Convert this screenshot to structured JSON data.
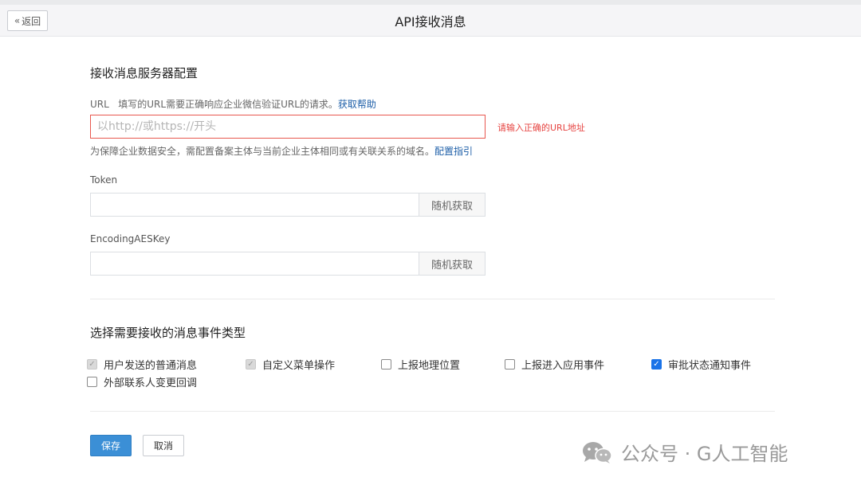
{
  "header": {
    "back_label": "返回",
    "title": "API接收消息"
  },
  "server_config": {
    "section_title": "接收消息服务器配置",
    "url_label": "URL",
    "url_hint": "填写的URL需要正确响应企业微信验证URL的请求。",
    "url_help_link": "获取帮助",
    "url_value": "",
    "url_placeholder": "以http://或https://开头",
    "url_error": "请输入正确的URL地址",
    "domain_hint": "为保障企业数据安全，需配置备案主体与当前企业主体相同或有关联关系的域名。",
    "domain_link": "配置指引",
    "token_label": "Token",
    "token_value": "",
    "token_random_label": "随机获取",
    "aes_label": "EncodingAESKey",
    "aes_value": "",
    "aes_random_label": "随机获取"
  },
  "event_types": {
    "section_title": "选择需要接收的消息事件类型",
    "options": [
      {
        "label": "用户发送的普通消息",
        "state": "checked-disabled"
      },
      {
        "label": "自定义菜单操作",
        "state": "checked-disabled"
      },
      {
        "label": "上报地理位置",
        "state": "unchecked"
      },
      {
        "label": "上报进入应用事件",
        "state": "unchecked"
      },
      {
        "label": "审批状态通知事件",
        "state": "checked"
      },
      {
        "label": "外部联系人变更回调",
        "state": "unchecked"
      }
    ]
  },
  "actions": {
    "save_label": "保存",
    "cancel_label": "取消"
  },
  "watermark": {
    "text": "公众号 · G人工智能",
    "icon": "wechat-icon"
  },
  "colors": {
    "primary": "#3b8fd6",
    "error": "#e64340",
    "link": "#1e5fa8",
    "checkbox_checked": "#1a73e8"
  }
}
